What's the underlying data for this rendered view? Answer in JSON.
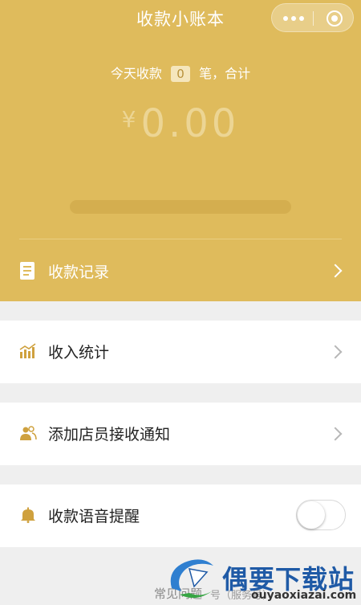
{
  "header": {
    "title": "收款小账本",
    "menu_icon": "more-dots-icon",
    "close_icon": "target-circle-icon"
  },
  "summary": {
    "prefix": "今天收款",
    "count": "0",
    "suffix": "笔，合计",
    "currency": "¥",
    "amount": "0.00",
    "progress_fraction": 0.0
  },
  "record_row": {
    "label": "收款记录",
    "icon": "document-icon"
  },
  "menu": {
    "income_stats": {
      "label": "收入统计",
      "icon": "bar-chart-icon"
    },
    "add_staff": {
      "label": "添加店员接收通知",
      "icon": "people-icon"
    },
    "voice_alert": {
      "label": "收款语音提醒",
      "icon": "bell-icon",
      "toggle_on": false
    }
  },
  "footer": {
    "faq": "常见问题",
    "small": "号（服务号）"
  },
  "watermark": {
    "brand": "偶要下载站",
    "url": "ouyaoxiazai.com"
  },
  "colors": {
    "header_bg": "#dfbb5c",
    "page_bg": "#efefef",
    "card_bg": "#ffffff",
    "icon_gold": "#cfa13e"
  }
}
